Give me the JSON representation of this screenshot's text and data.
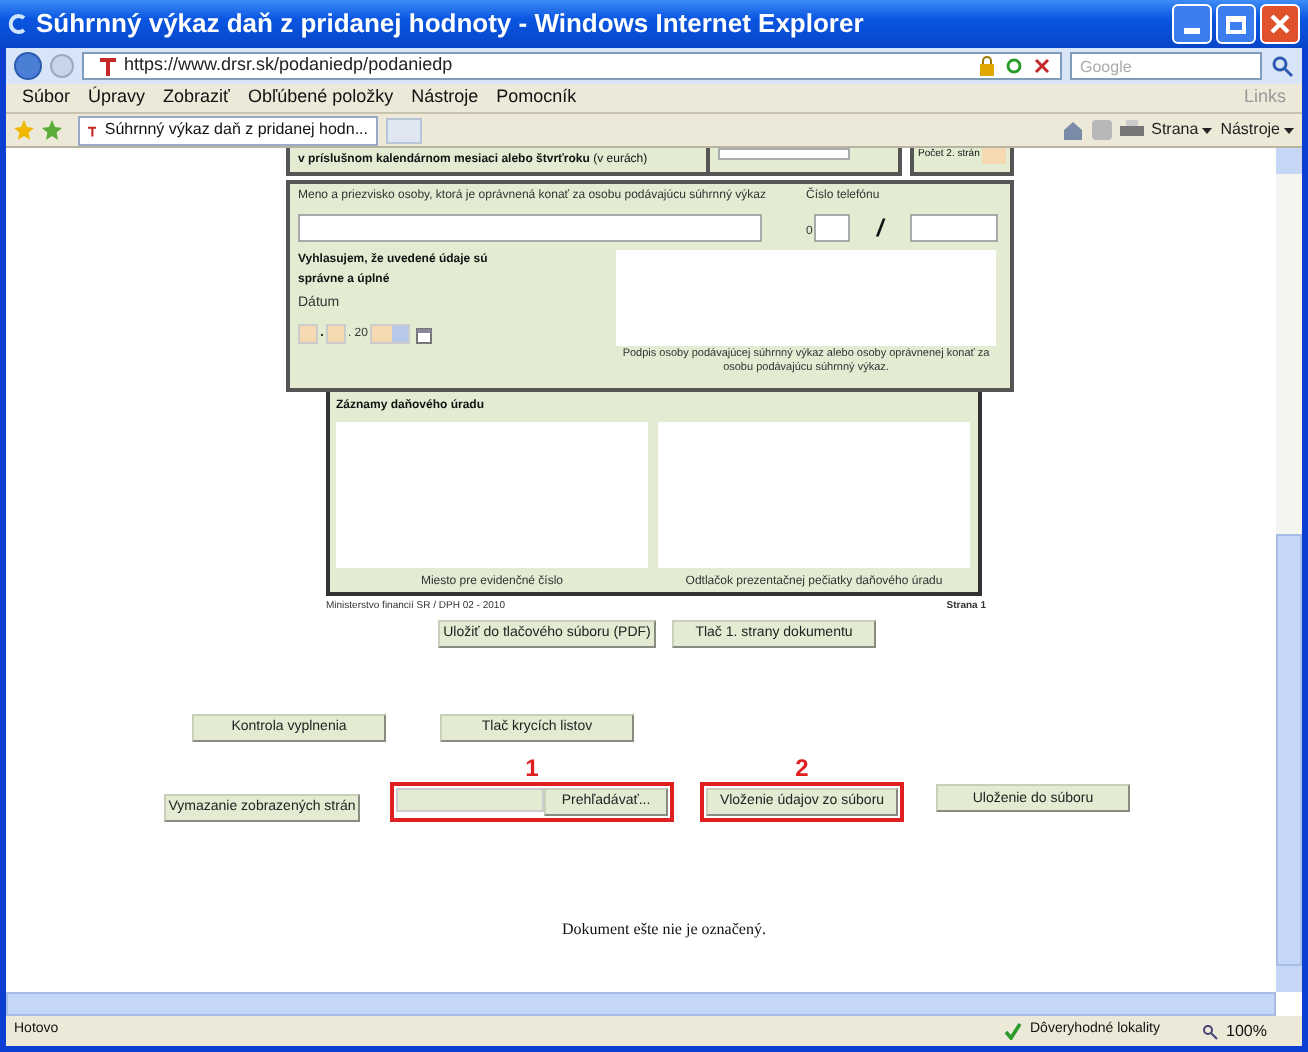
{
  "window": {
    "title": "Súhrnný výkaz daň z pridanej hodnoty - Windows Internet Explorer"
  },
  "address_bar": {
    "url": "https://www.drsr.sk/podaniedp/podaniedp"
  },
  "search": {
    "placeholder": "Google"
  },
  "menu": [
    "Súbor",
    "Úpravy",
    "Zobraziť",
    "Obľúbené položky",
    "Nástroje",
    "Pomocník"
  ],
  "links": "Links",
  "tab": {
    "title": "Súhrnný výkaz daň z pridanej hodn..."
  },
  "command_bar": [
    "Strana",
    "Nástroje"
  ],
  "form": {
    "top_row": {
      "label": "v príslušnom kalendárnom mesiaci alebo štvrťroku",
      "unit": "(v eurách)",
      "count_label": "Počet 2. strán"
    },
    "person": {
      "name_label": "Meno a priezvisko osoby, ktorá je oprávnená konať za osobu podávajúcu súhrnný výkaz",
      "phone_label": "Číslo telefónu",
      "phone_prefix": "0",
      "phone_separator": "/"
    },
    "declaration": {
      "text": "Vyhlasujem, že uvedené údaje sú správne a úplné",
      "date_label": "Dátum",
      "date_separator": ".",
      "year_prefix": ". 20",
      "signature_caption": "Podpis osoby podávajúcej súhrnný výkaz alebo osoby oprávnenej konať za osobu podávajúcu súhrnný výkaz."
    },
    "office": {
      "title": "Záznamy daňového úradu",
      "captions": [
        "Miesto pre evidenčné číslo",
        "Odtlačok prezentačnej pečiatky daňového úradu"
      ]
    },
    "footer": {
      "left": "Ministerstvo financií SR / DPH 02 - 2010",
      "right": "Strana 1"
    },
    "print_buttons": [
      "Uložiť do tlačového súboru (PDF)",
      "Tlač 1. strany dokumentu"
    ]
  },
  "buttons_row1": [
    "Kontrola vyplnenia",
    "Tlač krycích listov"
  ],
  "buttons_row2": {
    "clear": "Vymazanie zobrazených strán",
    "browse": "Prehľadávať...",
    "load": "Vloženie údajov zo súboru",
    "save": "Uloženie do súboru"
  },
  "annotations": [
    "1",
    "2"
  ],
  "document_status": "Dokument ešte nie je označený.",
  "status_bar": {
    "text": "Hotovo",
    "zone": "Dôveryhodné lokality",
    "zoom": "100%"
  }
}
